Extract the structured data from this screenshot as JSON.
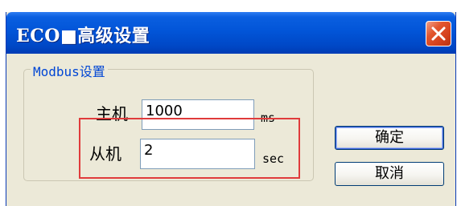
{
  "window": {
    "title": "ECO■高级设置",
    "close_icon": "close-icon"
  },
  "modbus_group": {
    "legend": "Modbus设置",
    "master": {
      "label": "主机",
      "value": "1000",
      "unit": "ms"
    },
    "slave": {
      "label": "从机",
      "value": "2",
      "unit": "sec"
    }
  },
  "buttons": {
    "ok": "确定",
    "cancel": "取消"
  },
  "colors": {
    "titlebar": "#0255d8",
    "close_button": "#d4401c",
    "dialog_bg": "#ece9d8",
    "group_legend": "#0046d5",
    "highlight_box": "#e03b3b"
  }
}
